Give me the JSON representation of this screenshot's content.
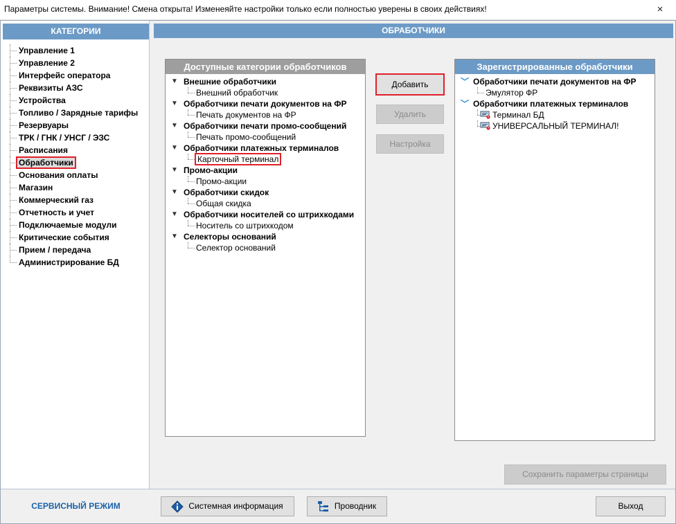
{
  "window": {
    "title": "Параметры системы.   Внимание! Смена открыта! Изменеяйте настройки только если полностью уверены в своих действиях!",
    "close_icon": "×"
  },
  "categories": {
    "header": "КАТЕГОРИИ",
    "items": [
      "Управление 1",
      "Управление 2",
      "Интерфейс оператора",
      "Реквизиты АЗС",
      "Устройства",
      "Топливо / Зарядные тарифы",
      "Резервуары",
      "ТРК / ГНК / УНСГ / ЭЗС",
      "Расписания",
      "Обработчики",
      "Основания оплаты",
      "Магазин",
      "Коммерческий газ",
      "Отчетность и учет",
      "Подключаемые модули",
      "Критические события",
      "Прием / передача",
      "Администрирование БД"
    ],
    "selected": "Обработчики"
  },
  "main": {
    "header": "ОБРАБОТЧИКИ"
  },
  "available": {
    "header": "Доступные категории обработчиков",
    "groups": [
      {
        "label": "Внешние обработчики",
        "children": [
          "Внешний обработчик"
        ]
      },
      {
        "label": "Обработчики печати документов на ФР",
        "children": [
          "Печать документов на ФР"
        ]
      },
      {
        "label": "Обработчики печати промо-сообщений",
        "children": [
          "Печать промо-сообщений"
        ]
      },
      {
        "label": "Обработчики платежных терминалов",
        "children": [
          "Карточный терминал"
        ]
      },
      {
        "label": "Промо-акции",
        "children": [
          "Промо-акции"
        ]
      },
      {
        "label": "Обработчики скидок",
        "children": [
          "Общая скидка"
        ]
      },
      {
        "label": "Обработчики носителей со штрихкодами",
        "children": [
          "Носитель со штрихкодом"
        ]
      },
      {
        "label": "Селекторы оснований",
        "children": [
          "Селектор оснований"
        ]
      }
    ],
    "highlighted": "Карточный терминал"
  },
  "registered": {
    "header": "Зарегистрированные обработчики",
    "groups": [
      {
        "label": "Обработчики печати документов на ФР",
        "children": [
          "Эмулятор ФР"
        ]
      },
      {
        "label": "Обработчики платежных терминалов",
        "children": [
          "Терминал БД",
          "УНИВЕРСАЛЬНЫЙ ТЕРМИНАЛ!"
        ]
      }
    ]
  },
  "buttons": {
    "add": "Добавить",
    "delete": "Удалить",
    "settings": "Настройка",
    "save_page": "Сохранить параметры страницы",
    "system_info": "Системная информация",
    "explorer": "Проводник",
    "exit": "Выход"
  },
  "footer": {
    "service_mode": "СЕРВИСНЫЙ РЕЖИМ"
  },
  "colors": {
    "accent_header": "#6c9ac6",
    "highlight_red": "#e0202a",
    "service_text": "#1c63a8"
  }
}
